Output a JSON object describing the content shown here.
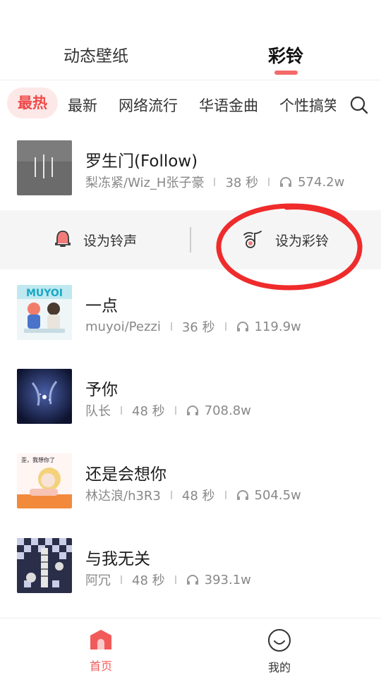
{
  "top_tabs": [
    {
      "label": "动态壁纸",
      "active": false
    },
    {
      "label": "彩铃",
      "active": true
    }
  ],
  "categories": [
    "最热",
    "最新",
    "网络流行",
    "华语金曲",
    "个性搞笑"
  ],
  "search_icon": "search-icon",
  "songs": [
    {
      "title": "罗生门(Follow)",
      "artist": "梨冻紧/Wiz_H张子豪",
      "duration": "38 秒",
      "plays": "574.2w"
    },
    {
      "title": "一点",
      "artist": "muyoi/Pezzi",
      "duration": "36 秒",
      "plays": "119.9w"
    },
    {
      "title": "予你",
      "artist": "队长",
      "duration": "48 秒",
      "plays": "708.8w"
    },
    {
      "title": "还是会想你",
      "artist": "林达浪/h3R3",
      "duration": "48 秒",
      "plays": "504.5w"
    },
    {
      "title": "与我无关",
      "artist": "阿冗",
      "duration": "48 秒",
      "plays": "393.1w"
    }
  ],
  "covers": {
    "c2_text": "MUYOI",
    "c4_text": "歪，我想你了"
  },
  "actions": {
    "set_ringtone": "设为铃声",
    "set_crbt": "设为彩铃"
  },
  "bottom_nav": [
    {
      "label": "首页",
      "active": true,
      "icon": "home-icon"
    },
    {
      "label": "我的",
      "active": false,
      "icon": "profile-icon"
    }
  ],
  "colors": {
    "accent": "#f25a5a",
    "active_pill_bg": "#fde8e8",
    "annotation_red": "#ef2b2b"
  }
}
